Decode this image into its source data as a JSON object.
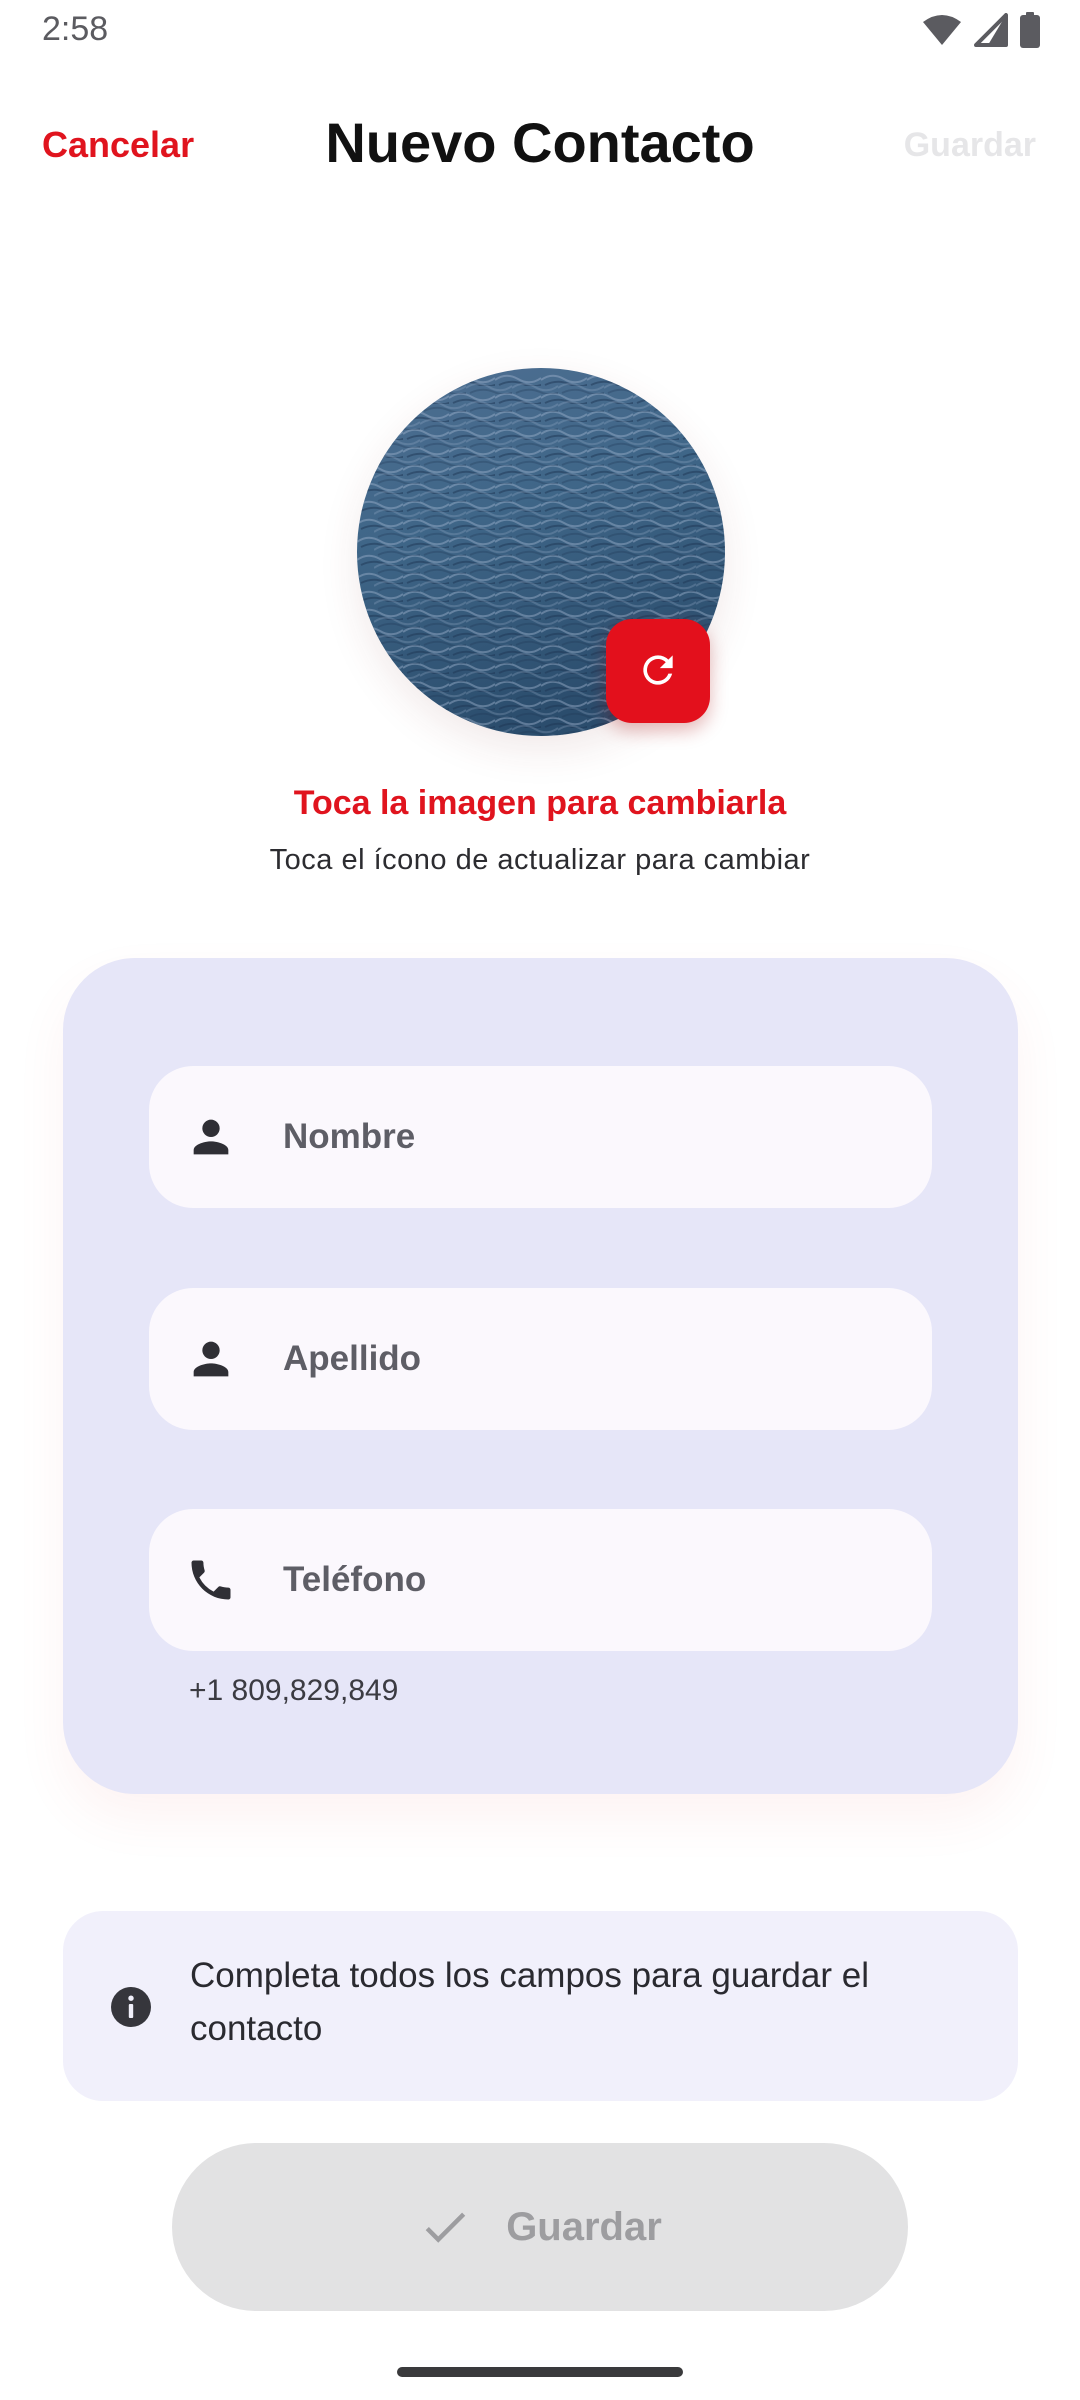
{
  "status_bar": {
    "time": "2:58",
    "icons": [
      "wifi-icon",
      "cellular-signal-icon",
      "battery-icon"
    ]
  },
  "header": {
    "cancel_label": "Cancelar",
    "title": "Nuevo Contacto",
    "save_label": "Guardar"
  },
  "avatar": {
    "image": "ocean-water-photo",
    "refresh_icon": "refresh-icon",
    "hint_primary": "Toca la imagen para cambiarla",
    "hint_secondary": "Toca el ícono de actualizar para cambiar"
  },
  "form": {
    "fields": [
      {
        "icon": "person-icon",
        "placeholder": "Nombre",
        "value": ""
      },
      {
        "icon": "person-icon",
        "placeholder": "Apellido",
        "value": ""
      },
      {
        "icon": "phone-icon",
        "placeholder": "Teléfono",
        "value": ""
      }
    ],
    "phone_helper": "+1 809,829,849"
  },
  "info": {
    "icon": "info-icon",
    "text": "Completa todos los campos para guardar el contacto"
  },
  "footer": {
    "save_icon": "check-icon",
    "save_label": "Guardar",
    "save_enabled": false
  },
  "colors": {
    "accent": "#e0141e",
    "card_background": "#e6e6f8",
    "field_background": "#fbf8fd",
    "info_background": "#f1f0fb",
    "disabled_button": "#e2e2e3"
  }
}
